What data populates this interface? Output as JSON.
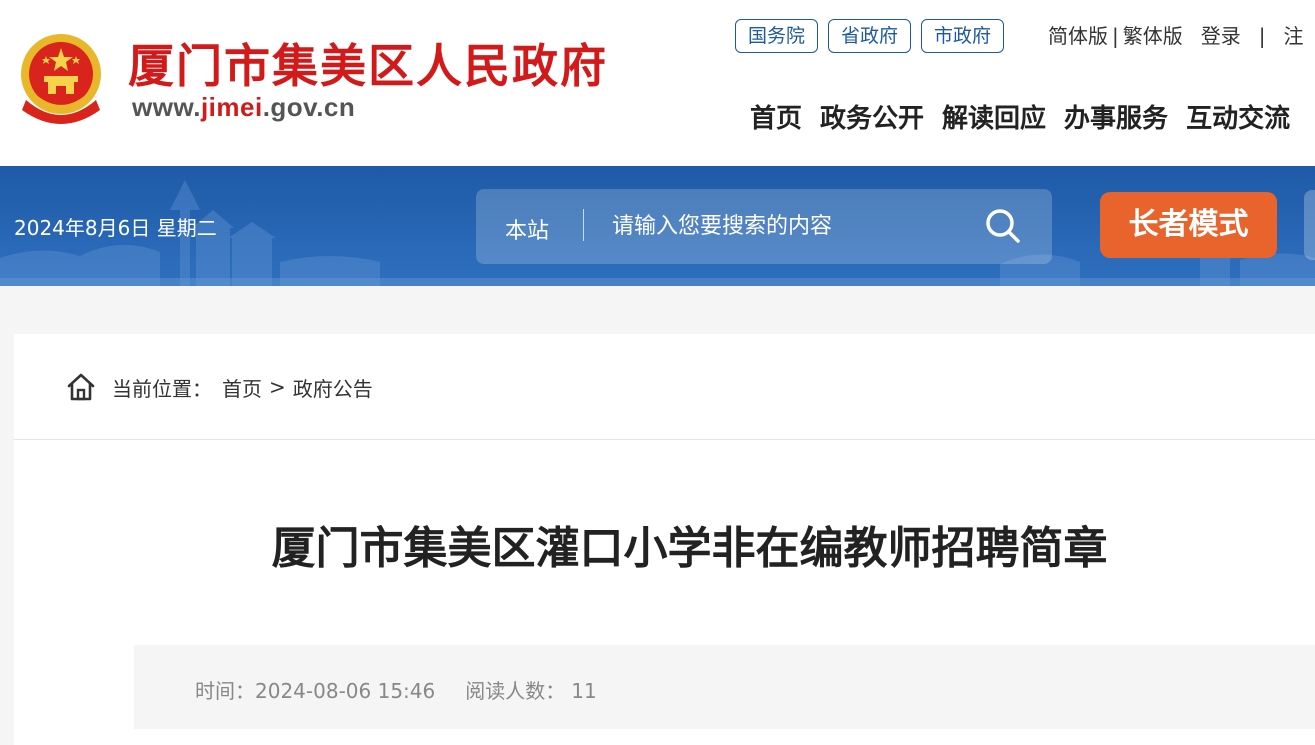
{
  "header": {
    "site_name": "厦门市集美区人民政府",
    "url_prefix": "www.",
    "url_highlight": "jimei",
    "url_suffix": ".gov.cn",
    "gov_links": [
      "国务院",
      "省政府",
      "市政府"
    ],
    "top_links": {
      "simplified": "简体版",
      "separator": "|",
      "traditional": "繁体版",
      "login": "登录",
      "separator2": "|",
      "register": "注"
    },
    "nav": [
      "首页",
      "政务公开",
      "解读回应",
      "办事服务",
      "互动交流"
    ]
  },
  "banner": {
    "date": "2024年8月6日 星期二",
    "search": {
      "scope": "本站",
      "placeholder": "请输入您要搜索的内容"
    },
    "elder_mode": "长者模式"
  },
  "breadcrumb": {
    "label": "当前位置：",
    "home": "首页",
    "arrow": ">",
    "current": "政府公告"
  },
  "article": {
    "title": "厦门市集美区灌口小学非在编教师招聘简章",
    "time_label": "时间：",
    "time_value": "2024-08-06 15:46",
    "reads_label": "阅读人数：",
    "reads_value": "11"
  },
  "colors": {
    "brand_red": "#d21a1a",
    "banner_blue": "#1e5aa8",
    "elder_orange": "#e9632c"
  }
}
